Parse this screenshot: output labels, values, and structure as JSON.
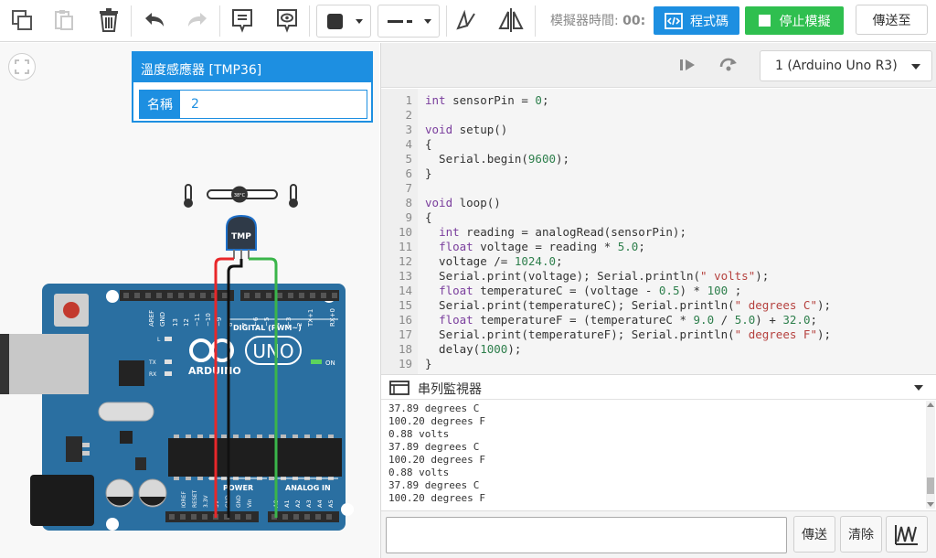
{
  "toolbar": {
    "icons": [
      "copy-icon",
      "paste-icon",
      "trash-icon",
      "undo-icon",
      "redo-icon",
      "notes-icon",
      "visibility-icon",
      "mirror-icon",
      "flip-icon"
    ],
    "fill_color": "#333333",
    "sim_time_label": "模擬器時間:",
    "sim_time_value": "00:",
    "code_button": "程式碼",
    "stop_button": "停止模擬",
    "export_button": "傳送至",
    "accent_blue": "#1d8fe1",
    "accent_green": "#2fbf4f"
  },
  "inspector": {
    "title": "溫度感應器 [TMP36]",
    "name_label": "名稱",
    "name_value": "2"
  },
  "circuit": {
    "sensor_label": "TMP",
    "slider_label": "38°C",
    "board_brand": "ARDUINO",
    "board_model": "UNO",
    "digital_label": "DIGITAL (PWM~)",
    "analog_label": "ANALOG IN",
    "power_label": "POWER",
    "led_on": "ON",
    "led_tx": "TX",
    "led_rx": "RX",
    "led_l": "L",
    "aref": "AREF",
    "gnd": "GND",
    "pins_top": [
      "13",
      "12",
      "~11",
      "~10",
      "~9",
      "8",
      "7",
      "~6",
      "~5",
      "4",
      "~3",
      "2",
      "TX+1",
      "RX+0"
    ],
    "pins_power": [
      "IOREF",
      "RESET",
      "3.3V",
      "5V",
      "GND",
      "GND",
      "Vin"
    ],
    "pins_analog": [
      "A0",
      "A1",
      "A2",
      "A3",
      "A4",
      "A5"
    ]
  },
  "code_panel": {
    "board_option": "1 (Arduino Uno R3)",
    "line_numbers": [
      "1",
      "2",
      "3",
      "4",
      "5",
      "6",
      "7",
      "8",
      "9",
      "10",
      "11",
      "12",
      "13",
      "14",
      "15",
      "16",
      "17",
      "18",
      "19"
    ],
    "lines": [
      [
        {
          "t": "int",
          "c": "k"
        },
        {
          "t": " sensorPin = "
        },
        {
          "t": "0",
          "c": "n"
        },
        {
          "t": ";"
        }
      ],
      [],
      [
        {
          "t": "void",
          "c": "k"
        },
        {
          "t": " setup()"
        }
      ],
      [
        {
          "t": "{"
        }
      ],
      [
        {
          "t": "  Serial.begin("
        },
        {
          "t": "9600",
          "c": "n"
        },
        {
          "t": ");"
        }
      ],
      [
        {
          "t": "}"
        }
      ],
      [],
      [
        {
          "t": "void",
          "c": "k"
        },
        {
          "t": " loop()"
        }
      ],
      [
        {
          "t": "{"
        }
      ],
      [
        {
          "t": "  "
        },
        {
          "t": "int",
          "c": "k"
        },
        {
          "t": " reading = analogRead(sensorPin);"
        }
      ],
      [
        {
          "t": "  "
        },
        {
          "t": "float",
          "c": "k"
        },
        {
          "t": " voltage = reading * "
        },
        {
          "t": "5.0",
          "c": "n"
        },
        {
          "t": ";"
        }
      ],
      [
        {
          "t": "  voltage /= "
        },
        {
          "t": "1024.0",
          "c": "n"
        },
        {
          "t": ";"
        }
      ],
      [
        {
          "t": "  Serial.print(voltage); Serial.println("
        },
        {
          "t": "\" volts\"",
          "c": "s"
        },
        {
          "t": ");"
        }
      ],
      [
        {
          "t": "  "
        },
        {
          "t": "float",
          "c": "k"
        },
        {
          "t": " temperatureC = (voltage - "
        },
        {
          "t": "0.5",
          "c": "n"
        },
        {
          "t": ") * "
        },
        {
          "t": "100",
          "c": "n"
        },
        {
          "t": " ;"
        }
      ],
      [
        {
          "t": "  Serial.print(temperatureC); Serial.println("
        },
        {
          "t": "\" degrees C\"",
          "c": "s"
        },
        {
          "t": ");"
        }
      ],
      [
        {
          "t": "  "
        },
        {
          "t": "float",
          "c": "k"
        },
        {
          "t": " temperatureF = (temperatureC * "
        },
        {
          "t": "9.0",
          "c": "n"
        },
        {
          "t": " / "
        },
        {
          "t": "5.0",
          "c": "n"
        },
        {
          "t": ") + "
        },
        {
          "t": "32.0",
          "c": "n"
        },
        {
          "t": ";"
        }
      ],
      [
        {
          "t": "  Serial.print(temperatureF); Serial.println("
        },
        {
          "t": "\" degrees F\"",
          "c": "s"
        },
        {
          "t": ");"
        }
      ],
      [
        {
          "t": "  delay("
        },
        {
          "t": "1000",
          "c": "n"
        },
        {
          "t": ");"
        }
      ],
      [
        {
          "t": "}"
        }
      ]
    ]
  },
  "serial_monitor": {
    "title": "串列監視器",
    "lines": [
      "37.89 degrees C",
      "100.20 degrees F",
      "0.88 volts",
      "37.89 degrees C",
      "100.20 degrees F",
      "0.88 volts",
      "37.89 degrees C",
      "100.20 degrees F"
    ],
    "send_button": "傳送",
    "clear_button": "清除",
    "graph_icon": "graph-icon"
  }
}
